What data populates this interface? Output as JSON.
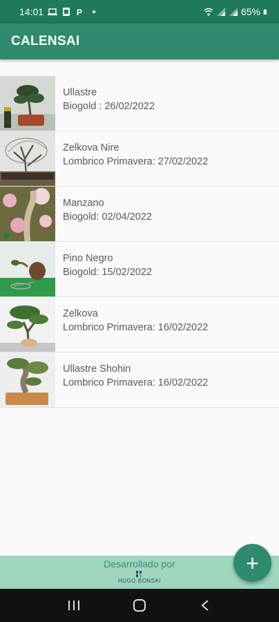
{
  "status_bar": {
    "time": "14:01",
    "battery": "65%",
    "left_icons": [
      "laptop-icon",
      "notification-icon",
      "parking-icon",
      "dot-icon"
    ],
    "right_icons": [
      "wifi-icon",
      "signal-icon",
      "signal-icon",
      "battery-icon"
    ]
  },
  "app_bar": {
    "title": "CALENSAI"
  },
  "items": [
    {
      "name": "Ullastre",
      "detail": "Biogold : 26/02/2022"
    },
    {
      "name": "Zelkova Nire",
      "detail": "Lombrico Primavera: 27/02/2022"
    },
    {
      "name": "Manzano",
      "detail": "Biogold: 02/04/2022"
    },
    {
      "name": "Pino Negro",
      "detail": "Biogold: 15/02/2022"
    },
    {
      "name": "Zelkova",
      "detail": "Lombrico Primavera: 16/02/2022"
    },
    {
      "name": "Ullastre Shohin",
      "detail": "Lombrico Primavera: 16/02/2022"
    }
  ],
  "footer": {
    "text": "Desarrollado por",
    "logo_text": "HUGO BONSAI"
  },
  "fab": {
    "label": "+"
  },
  "nav": {
    "icons": [
      "recents-icon",
      "home-icon",
      "back-icon"
    ]
  },
  "colors": {
    "primary": "#2e8b6d",
    "status": "#1f7a5a",
    "footer": "#9fd6be"
  }
}
